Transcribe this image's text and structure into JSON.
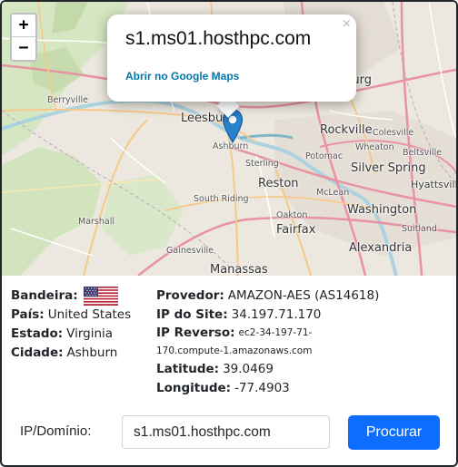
{
  "map": {
    "zoom_in_label": "+",
    "zoom_out_label": "−",
    "popup": {
      "title": "s1.ms01.hosthpc.com",
      "link_label": "Abrir no Google Maps",
      "close_label": "×"
    },
    "places": {
      "gaithersburg": "Gaithersburg",
      "rockville": "Rockville",
      "colesville": "Colesville",
      "wheaton": "Wheaton",
      "beltsville": "Beltsville",
      "silver_spring": "Silver Spring",
      "hyattsville": "Hyattsville",
      "potomac": "Potomac",
      "leesburg": "Leesburg",
      "ashburn": "Ashburn",
      "sterling": "Sterling",
      "reston": "Reston",
      "mclean": "McLean",
      "washington": "Washington",
      "berryville": "Berryville",
      "south_riding": "South Riding",
      "oakton": "Oakton",
      "fairfax": "Fairfax",
      "suitland": "Suitland",
      "marshall": "Marshall",
      "alexandria": "Alexandria",
      "gainesville": "Gainesville",
      "manassas": "Manassas"
    },
    "colors": {
      "land": "#ece8df",
      "forest": "#cfe3bd",
      "water": "#aad3df",
      "road_major": "#e892a2",
      "road_mid": "#f6c88a",
      "marker": "#2a81cb"
    }
  },
  "info": {
    "left": [
      {
        "key": "Bandeira:",
        "value": "",
        "icon": "us-flag-icon"
      },
      {
        "key": "País:",
        "value": "United States"
      },
      {
        "key": "Estado:",
        "value": "Virginia"
      },
      {
        "key": "Cidade:",
        "value": "Ashburn"
      }
    ],
    "right": {
      "provider_key": "Provedor:",
      "provider_value": "AMAZON-AES (AS14618)",
      "ip_key": "IP do Site:",
      "ip_value": "34.197.71.170",
      "reverse_key": "IP Reverso:",
      "reverse_value_1": "ec2-34-197-71-",
      "reverse_value_2": "170.compute-1.amazonaws.com",
      "lat_key": "Latitude:",
      "lat_value": "39.0469",
      "lon_key": "Longitude:",
      "lon_value": "-77.4903"
    }
  },
  "search": {
    "label": "IP/Domínio:",
    "value": "s1.ms01.hosthpc.com",
    "button_label": "Procurar"
  }
}
